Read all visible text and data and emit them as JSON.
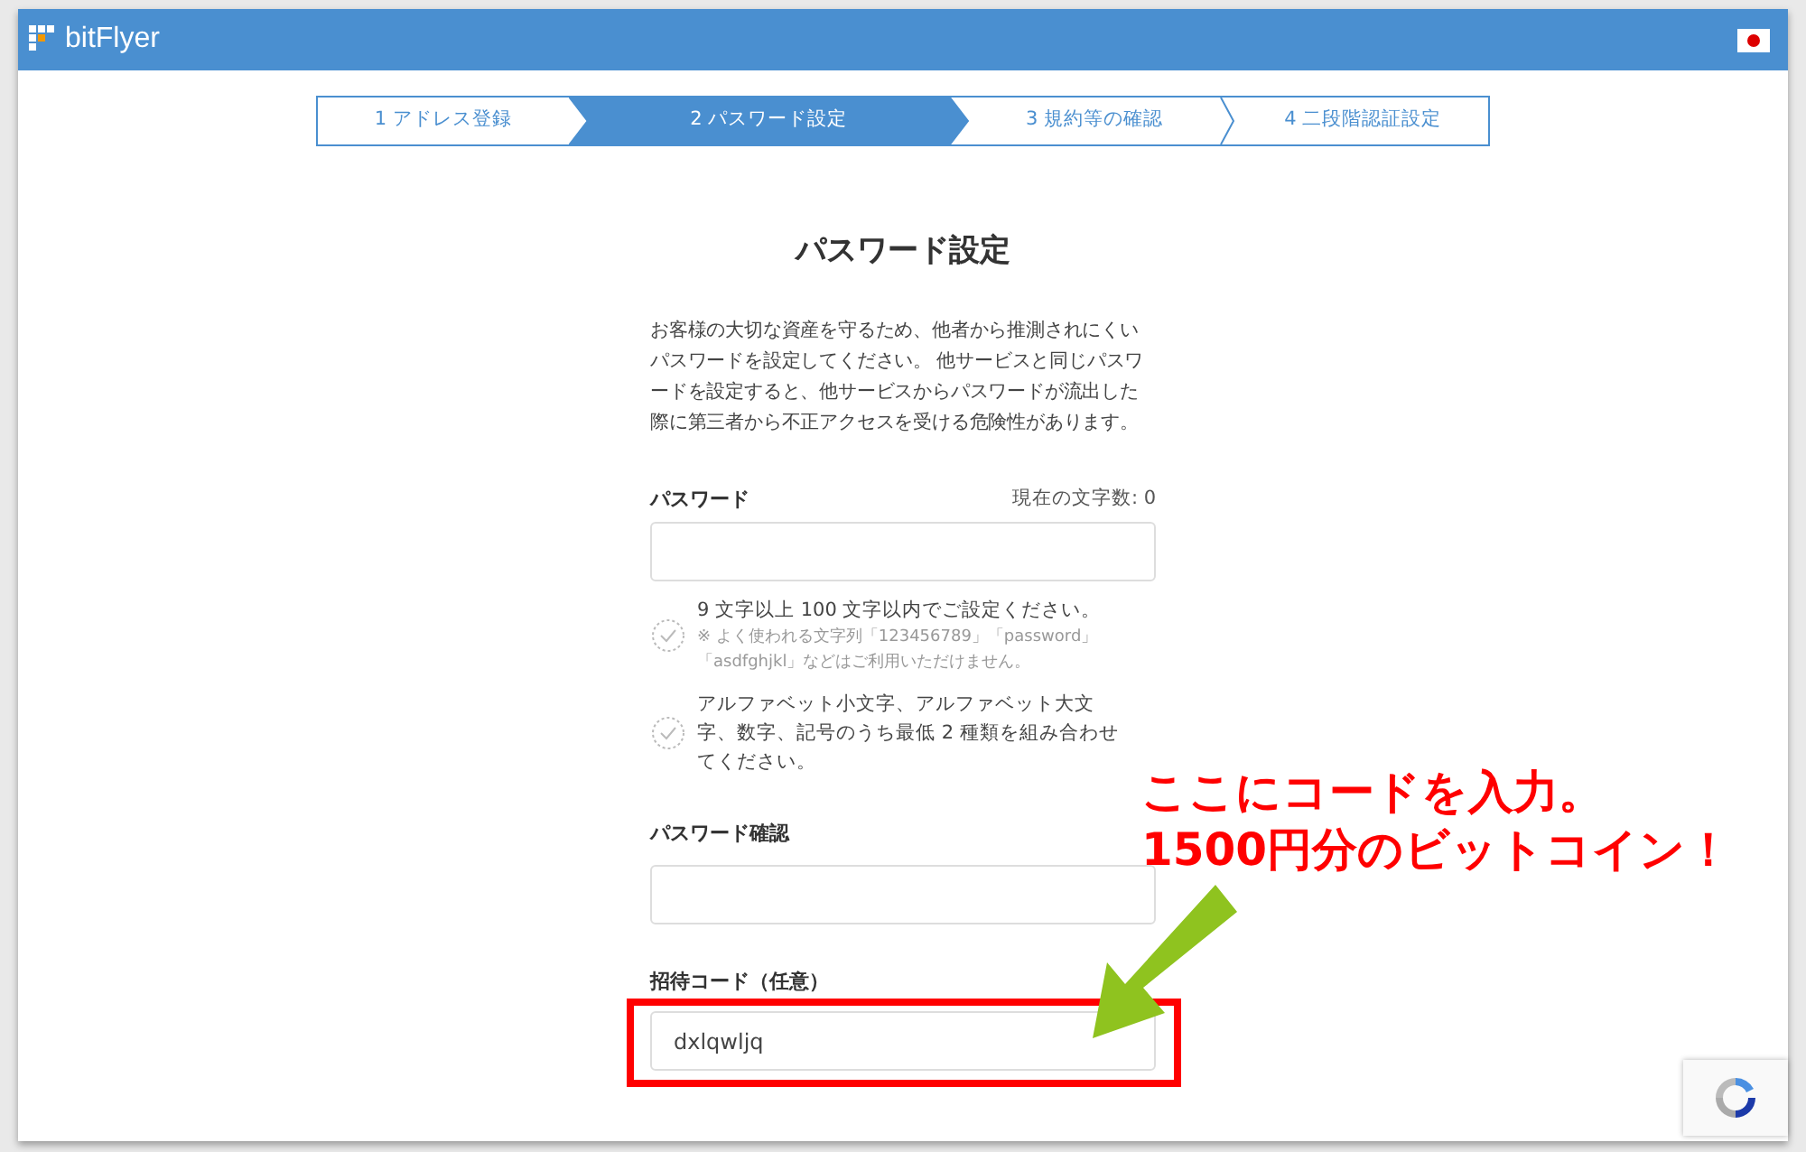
{
  "header": {
    "logo": "bitFlyer"
  },
  "steps": [
    {
      "label": "1 アドレス登録",
      "selected": false
    },
    {
      "label": "2 パスワード設定",
      "selected": true
    },
    {
      "label": "3 規約等の確認",
      "selected": false
    },
    {
      "label": "4 二段階認証設定",
      "selected": false
    }
  ],
  "title": "パスワード設定",
  "intro": "お客様の大切な資産を守るため、他者から推測されにくいパスワードを設定してください。 他サービスと同じパスワードを設定すると、他サービスからパスワードが流出した際に第三者から不正アクセスを受ける危険性があります。",
  "password": {
    "label": "パスワード",
    "counter": "現在の文字数: 0"
  },
  "rules": [
    {
      "text": "9 文字以上 100 文字以内でご設定ください。",
      "note": "※ よく使われる文字列「123456789」「password」「asdfghjkl」などはご利用いただけません。",
      "met": false
    },
    {
      "text": "アルファベット小文字、アルファベット大文字、数字、記号のうち最低 2 種類を組み合わせてください。",
      "met": false
    }
  ],
  "confirm": {
    "label": "パスワード確認"
  },
  "invite": {
    "label": "招待コード（任意）",
    "value": "dxlqwljq"
  },
  "annotation": {
    "lines": [
      "ここにコードを入力。",
      "1500円分のビットコイン！"
    ]
  }
}
